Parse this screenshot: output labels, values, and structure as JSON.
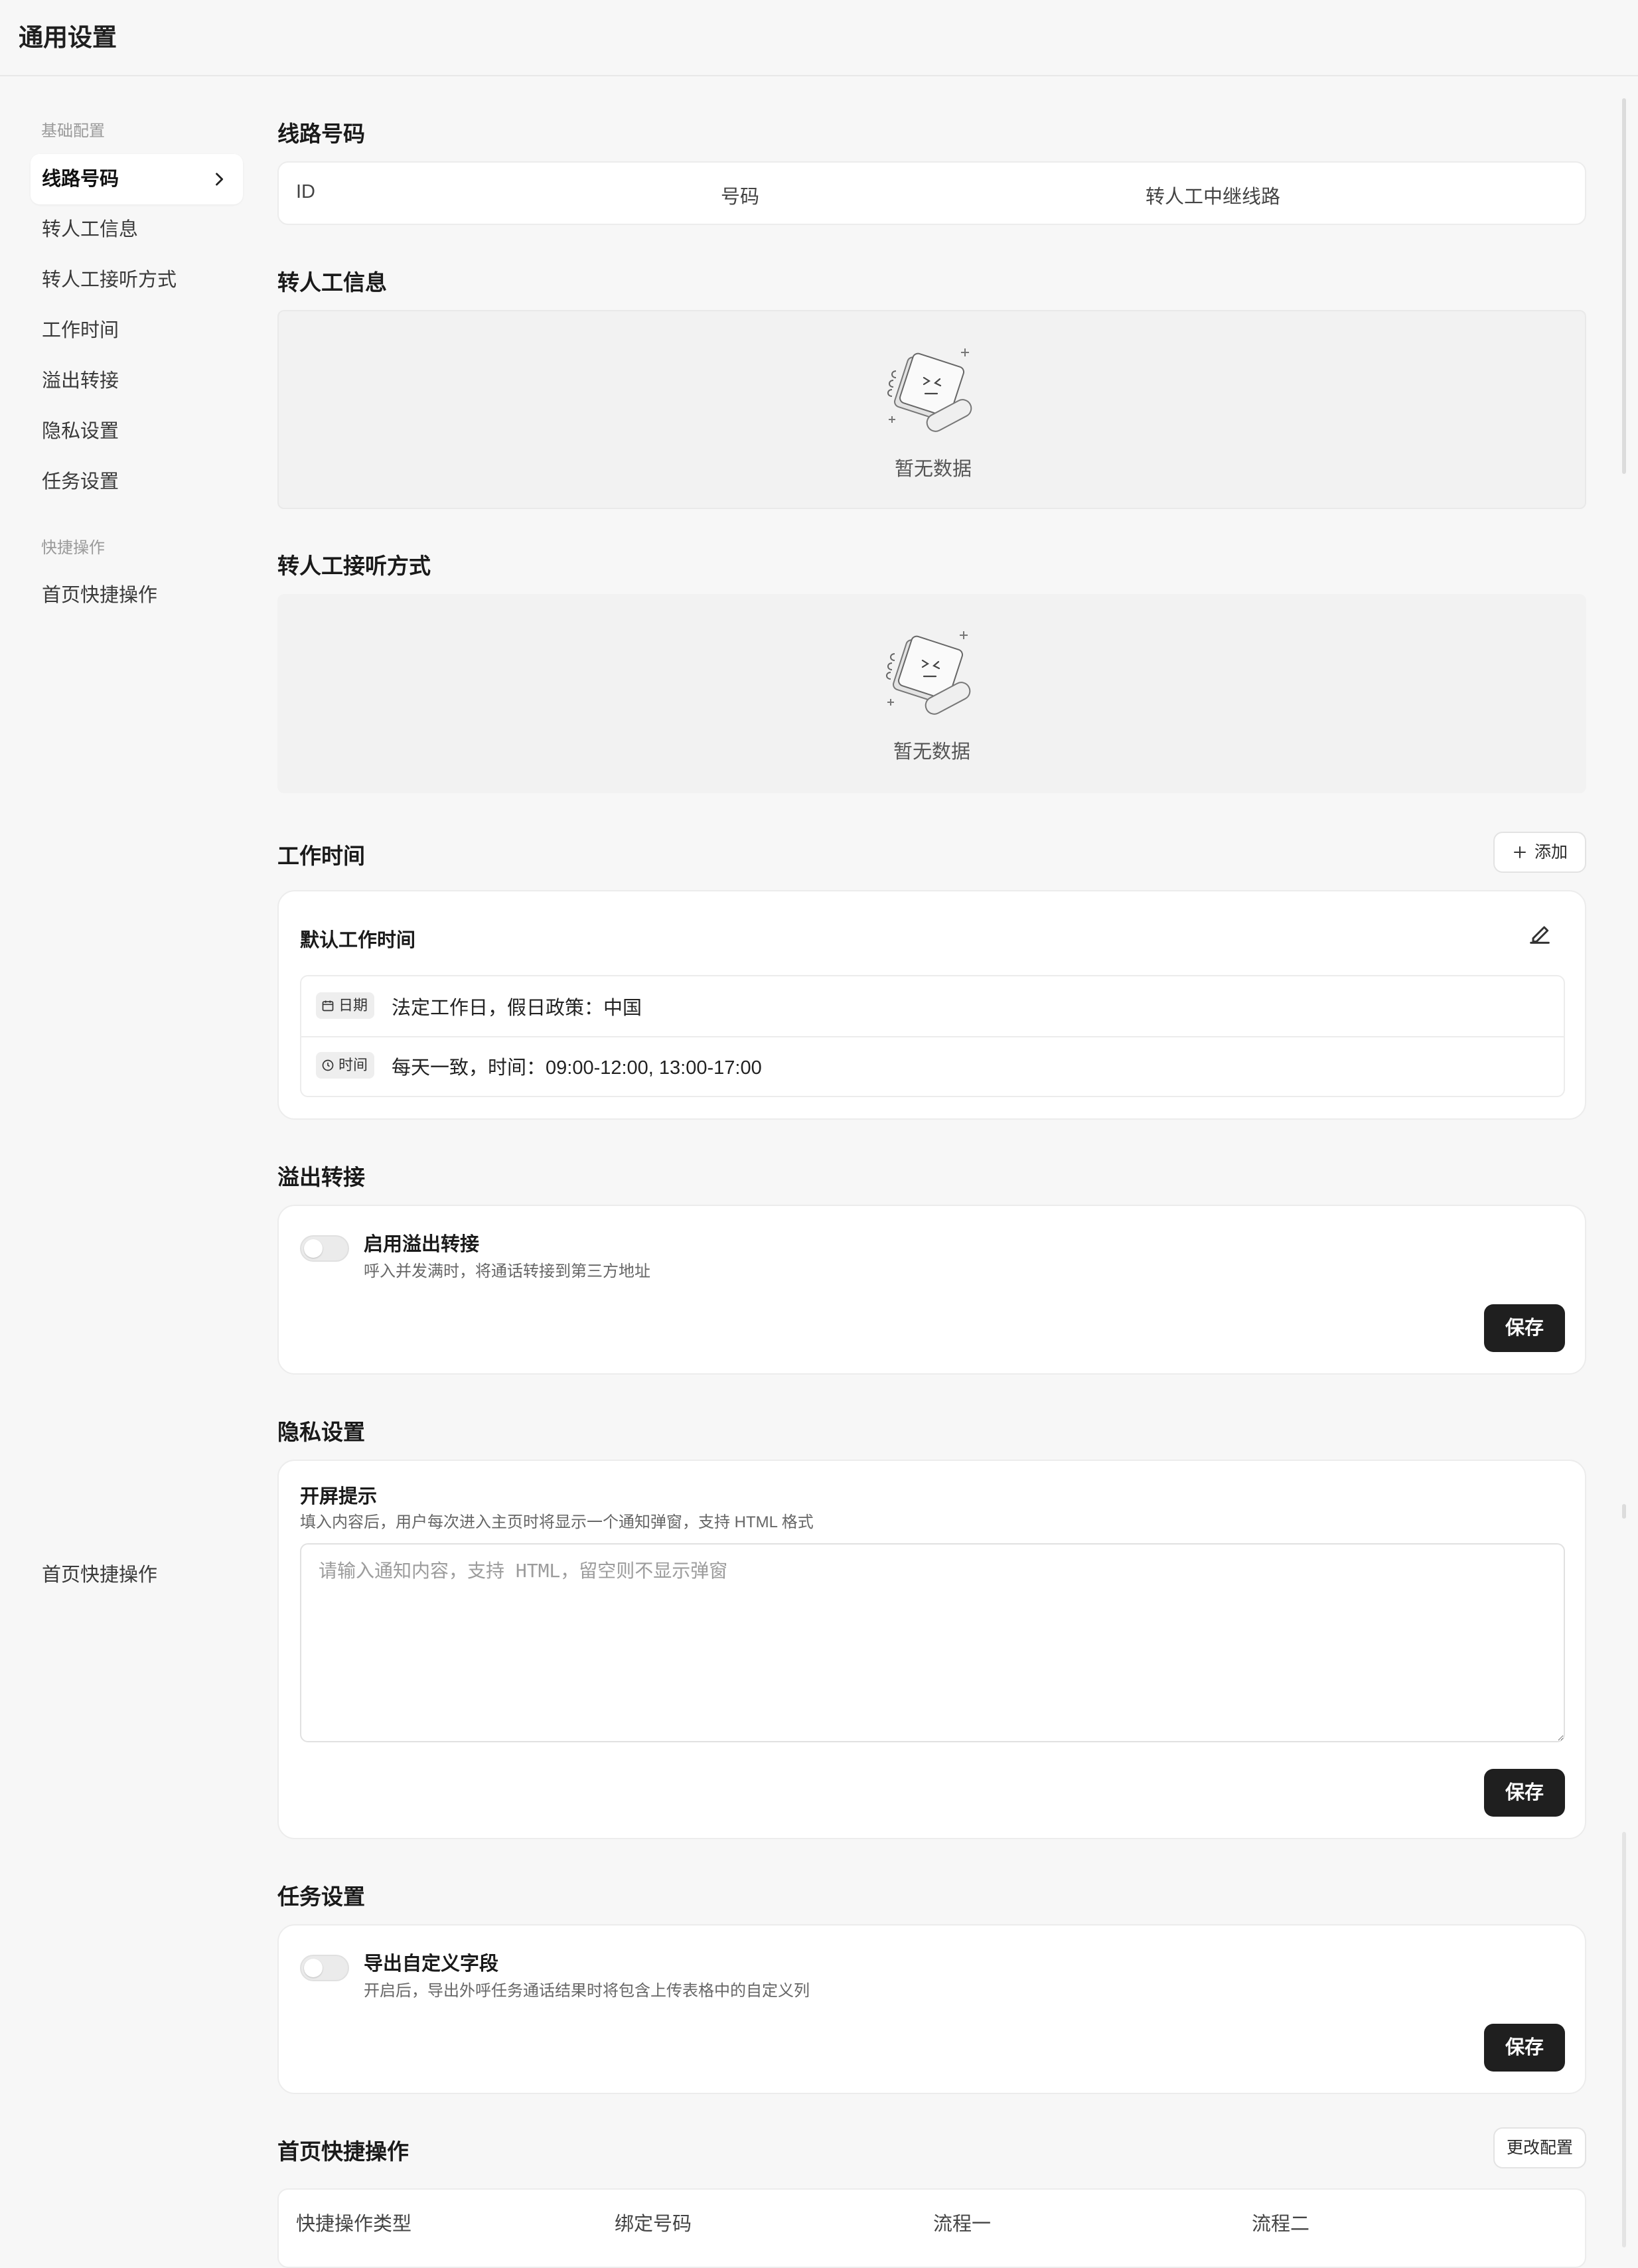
{
  "page": {
    "title": "通用设置"
  },
  "sidebar": {
    "groups": [
      {
        "label": "基础配置"
      },
      {
        "label": "快捷操作"
      }
    ],
    "items": [
      {
        "label": "线路号码"
      },
      {
        "label": "转人工信息"
      },
      {
        "label": "转人工接听方式"
      },
      {
        "label": "工作时间"
      },
      {
        "label": "溢出转接"
      },
      {
        "label": "隐私设置"
      },
      {
        "label": "任务设置"
      },
      {
        "label": "首页快捷操作"
      }
    ],
    "floating_label": "首页快捷操作"
  },
  "sections": {
    "lines": {
      "title": "线路号码",
      "columns": [
        "ID",
        "号码",
        "转人工中继线路"
      ]
    },
    "transfer_info": {
      "title": "转人工信息",
      "empty_text": "暂无数据"
    },
    "transfer_answer": {
      "title": "转人工接听方式",
      "empty_text": "暂无数据"
    },
    "work_time": {
      "title": "工作时间",
      "add_label": "添加",
      "card_title": "默认工作时间",
      "rows": [
        {
          "tag": "日期",
          "icon": "calendar-icon",
          "text": "法定工作日，假日政策：中国"
        },
        {
          "tag": "时间",
          "icon": "clock-icon",
          "text": "每天一致，时间：09:00-12:00, 13:00-17:00"
        }
      ]
    },
    "overflow": {
      "title": "溢出转接",
      "option_title": "启用溢出转接",
      "option_desc": "呼入并发满时，将通话转接到第三方地址",
      "enabled": false,
      "save_label": "保存"
    },
    "privacy": {
      "title": "隐私设置",
      "field_title": "开屏提示",
      "field_desc": "填入内容后，用户每次进入主页时将显示一个通知弹窗，支持 HTML 格式",
      "placeholder": "请输入通知内容，支持 HTML，留空则不显示弹窗",
      "value": "",
      "save_label": "保存"
    },
    "task": {
      "title": "任务设置",
      "option_title": "导出自定义字段",
      "option_desc": "开启后，导出外呼任务通话结果时将包含上传表格中的自定义列",
      "enabled": false,
      "save_label": "保存"
    },
    "shortcuts": {
      "title": "首页快捷操作",
      "change_label": "更改配置",
      "columns": [
        "快捷操作类型",
        "绑定号码",
        "流程一",
        "流程二"
      ]
    }
  }
}
